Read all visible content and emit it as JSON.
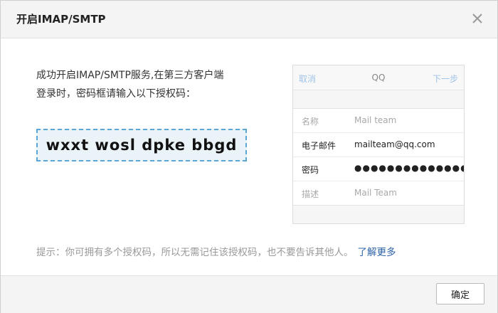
{
  "dialog": {
    "title": "开启IMAP/SMTP",
    "close_icon": "close-icon"
  },
  "intro": {
    "text": "成功开启IMAP/SMTP服务,在第三方客户端\n登录时，密码框请输入以下授权码："
  },
  "auth_code": "wxxt wosl dpke bbgd",
  "phone_mock": {
    "nav": {
      "cancel": "取消",
      "title": "QQ",
      "next": "下一步"
    },
    "rows": [
      {
        "label": "名称",
        "value": "Mail team"
      },
      {
        "label": "电子邮件",
        "value": "mailteam@qq.com"
      },
      {
        "label": "密码",
        "value": "●●●●●●●●●●●●●●●●"
      },
      {
        "label": "描述",
        "value": "Mail Team"
      }
    ]
  },
  "hint": {
    "text": "提示：你可拥有多个授权码，所以无需记住该授权码，也不要告诉其他人。",
    "link": "了解更多"
  },
  "footer": {
    "ok_label": "确定"
  }
}
